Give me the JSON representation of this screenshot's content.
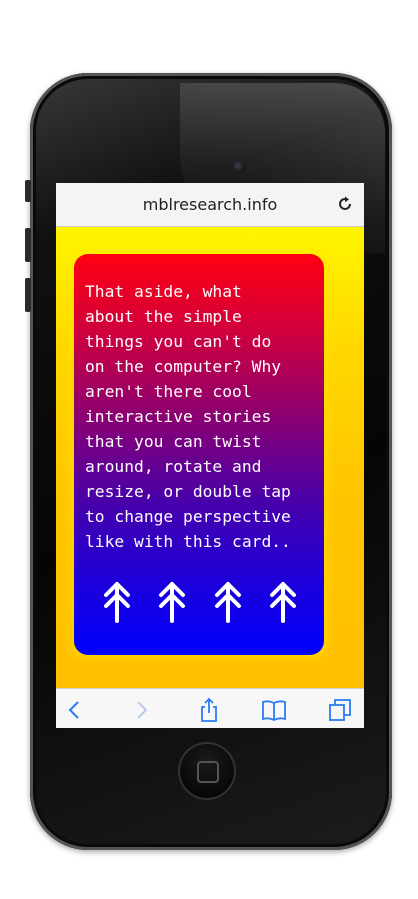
{
  "browser": {
    "url": "mblresearch.info",
    "reload_icon": "reload-icon"
  },
  "card": {
    "text": "That aside, what\nabout the simple\nthings you can't do\non the computer? Why\naren't there cool\ninteractive stories\nthat you can twist\naround, rotate and\nresize, or double tap\nto change perspective\nlike with this card..",
    "arrow_icon": "double-up-arrow-icon",
    "arrow_count": 4
  },
  "toolbar": {
    "back_icon": "chevron-left-icon",
    "forward_icon": "chevron-right-icon",
    "share_icon": "share-icon",
    "bookmarks_icon": "book-icon",
    "tabs_icon": "tabs-icon"
  },
  "colors": {
    "background_yellow": "#ffd800",
    "card_top": "#ff0010",
    "card_bottom": "#0000ff",
    "toolbar_accent": "#2a7cf6"
  }
}
